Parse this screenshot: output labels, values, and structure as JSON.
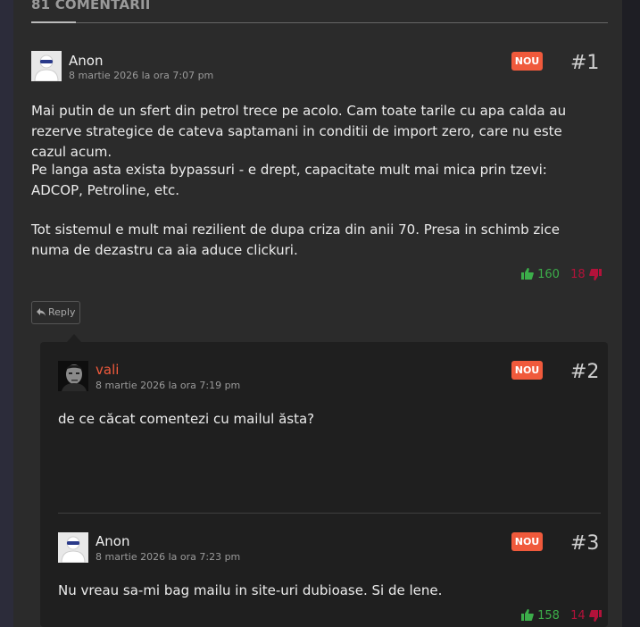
{
  "section": {
    "title": "81 COMENTARII"
  },
  "badge_label": "NOU",
  "colors": {
    "accent": "#f05a3c",
    "upvote": "#3cae4a",
    "downvote": "#b3123a"
  },
  "comments": [
    {
      "number": "#1",
      "author": "Anon",
      "date": "8 martie 2026 la ora 7:07 pm",
      "avatar": "masked-anon-avatar",
      "paragraphs": [
        "Mai putin de un sfert din petrol trece pe acolo. Cam toate tarile cu apa calda au rezerve strategice de cateva saptamani in conditii de import zero, care nu este cazul acum.",
        "Pe langa asta exista bypassuri - e drept, capacitate mult mai mica prin tzevi: ADCOP, Petroline, etc.",
        "Tot sistemul e mult mai rezilient de dupa criza din anii 70. Presa in schimb zice numa de dezastru ca aia aduce clickuri."
      ],
      "upvotes": "160",
      "downvotes": "18",
      "reply_label": "Reply"
    },
    {
      "number": "#2",
      "author": "vali",
      "date": "8 martie 2026 la ora 7:19 pm",
      "avatar": "user-photo-avatar",
      "paragraphs": [
        "de ce căcat comentezi cu mailul ăsta?"
      ]
    },
    {
      "number": "#3",
      "author": "Anon",
      "date": "8 martie 2026 la ora 7:23 pm",
      "avatar": "masked-anon-avatar",
      "paragraphs": [
        "Nu vreau sa-mi bag mailu in site-uri dubioase. Si de lene."
      ],
      "upvotes": "158",
      "downvotes": "14"
    }
  ]
}
